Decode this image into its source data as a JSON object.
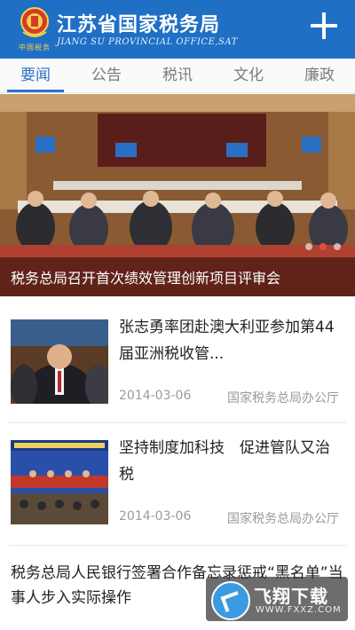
{
  "header": {
    "title_cn": "江苏省国家税务局",
    "title_en": "JIANG SU PROVINCIAL OFFICE,SAT",
    "emblem_caption": "中国税务"
  },
  "tabs": [
    {
      "label": "要闻",
      "active": true
    },
    {
      "label": "公告",
      "active": false
    },
    {
      "label": "税讯",
      "active": false
    },
    {
      "label": "文化",
      "active": false
    },
    {
      "label": "廉政",
      "active": false
    }
  ],
  "hero": {
    "caption": "税务总局召开首次绩效管理创新项目评审会",
    "active_slide": 2,
    "slide_count": 3
  },
  "news": [
    {
      "title": "张志勇率团赴澳大利亚参加第44届亚洲税收管...",
      "date": "2014-03-06",
      "source": "国家税务总局办公厅"
    },
    {
      "title": "坚持制度加科技　促进管队又治税",
      "date": "2014-03-06",
      "source": "国家税务总局办公厅"
    }
  ],
  "text_item": {
    "title": "税务总局人民银行签署合作备忘录惩戒“黑名单”当事人步入实际操作"
  },
  "watermark": {
    "text": "飞翔下载",
    "url": "WWW.FXXZ.COM"
  },
  "colors": {
    "header_bg": "#1f6fc5",
    "tab_active": "#2a72c8",
    "dot_active": "#e24b3b"
  }
}
